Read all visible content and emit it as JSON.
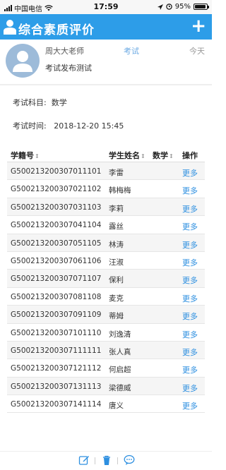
{
  "statusbar": {
    "carrier": "中国电信",
    "time": "17:59",
    "battery": "95%",
    "battery_level": 0.95
  },
  "appbar": {
    "title": "综合素质评价",
    "add_label": "+"
  },
  "message": {
    "sender": "周大大老师",
    "category": "考试",
    "date": "今天",
    "title": "考试发布测试"
  },
  "exam": {
    "subject_label": "考试科目:",
    "subject_value": "数学",
    "time_label": "考试时间:",
    "time_value": "2018-12-20 15:45"
  },
  "table": {
    "headers": {
      "id": "学籍号",
      "name": "学生姓名",
      "math": "数学",
      "action": "操作"
    },
    "rows": [
      {
        "id": "G500213200307011101",
        "name": "李雷",
        "action": "更多"
      },
      {
        "id": "G500213200307021102",
        "name": "韩梅梅",
        "action": "更多"
      },
      {
        "id": "G500213200307031103",
        "name": "李莉",
        "action": "更多"
      },
      {
        "id": "G500213200307041104",
        "name": "露丝",
        "action": "更多"
      },
      {
        "id": "G500213200307051105",
        "name": "林涛",
        "action": "更多"
      },
      {
        "id": "G500213200307061106",
        "name": "汪淑",
        "action": "更多"
      },
      {
        "id": "G500213200307071107",
        "name": "保利",
        "action": "更多"
      },
      {
        "id": "G500213200307081108",
        "name": "麦克",
        "action": "更多"
      },
      {
        "id": "G500213200307091109",
        "name": "蒂姆",
        "action": "更多"
      },
      {
        "id": "G500213200307101110",
        "name": "刘逸清",
        "action": "更多"
      },
      {
        "id": "G500213200307111111",
        "name": "张人真",
        "action": "更多"
      },
      {
        "id": "G500213200307121112",
        "name": "何启超",
        "action": "更多"
      },
      {
        "id": "G500213200307131113",
        "name": "梁德威",
        "action": "更多"
      },
      {
        "id": "G500213200307141114",
        "name": "唐义",
        "action": "更多"
      }
    ]
  },
  "colors": {
    "primary": "#2d9de8",
    "link": "#2d8fe0"
  },
  "toolbar": {
    "icons": [
      "edit-icon",
      "trash-icon",
      "comment-icon"
    ]
  }
}
